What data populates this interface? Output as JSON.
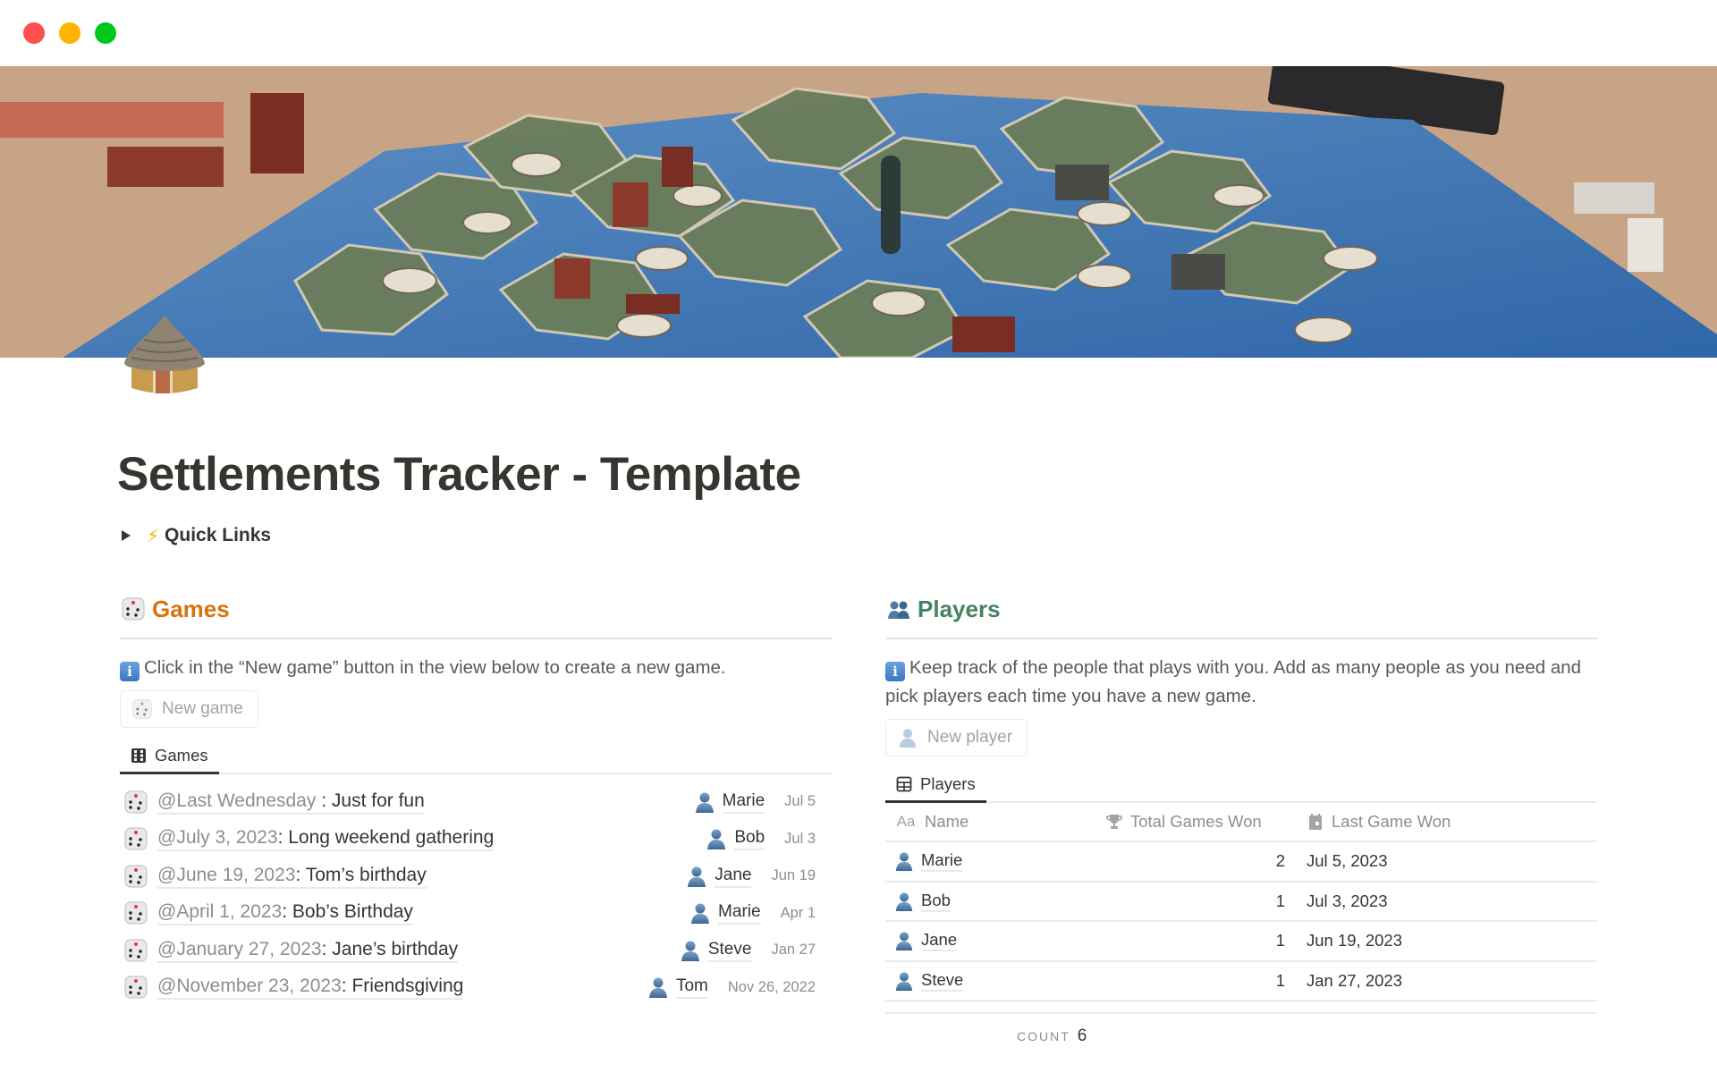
{
  "window": {
    "controls": [
      "close",
      "minimize",
      "zoom"
    ]
  },
  "cover": {
    "description": "Board game (Catan-style hex board) on wooden table",
    "icon": "hut-icon"
  },
  "page": {
    "title": "Settlements Tracker - Template",
    "toggle": {
      "icon": "lightning-icon",
      "label": "Quick Links",
      "expanded": false
    }
  },
  "games": {
    "heading": "Games",
    "heading_icon": "dice-icon",
    "heading_color": "#D9730D",
    "note": "Click in the “New game” button in the view below to create a new game.",
    "new_button": "New game",
    "tab": "Games",
    "rows": [
      {
        "mention": "@Last Wednesday",
        "sep": " : ",
        "title": "Just for fun",
        "winner": "Marie",
        "date": "Jul 5"
      },
      {
        "mention": "@July 3, 2023",
        "sep": ": ",
        "title": "Long weekend gathering",
        "winner": "Bob",
        "date": "Jul 3"
      },
      {
        "mention": "@June 19, 2023",
        "sep": ": ",
        "title": "Tom’s birthday",
        "winner": "Jane",
        "date": "Jun 19"
      },
      {
        "mention": "@April 1, 2023",
        "sep": ": ",
        "title": "Bob’s Birthday",
        "winner": "Marie",
        "date": "Apr 1"
      },
      {
        "mention": "@January 27, 2023",
        "sep": ": ",
        "title": "Jane’s birthday",
        "winner": "Steve",
        "date": "Jan 27"
      },
      {
        "mention": "@November 23, 2023",
        "sep": ": ",
        "title": "Friendsgiving",
        "winner": "Tom",
        "date": "Nov 26, 2022"
      }
    ]
  },
  "players": {
    "heading": "Players",
    "heading_icon": "busts-icon",
    "heading_color": "#448361",
    "note": "Keep track of the people that plays with you. Add as many people as you need and pick players each time you have a new game.",
    "new_button": "New player",
    "tab": "Players",
    "columns": [
      {
        "icon": "Aa",
        "label": "Name"
      },
      {
        "icon": "trophy-icon",
        "label": "Total Games Won"
      },
      {
        "icon": "calendar-icon",
        "label": "Last Game Won"
      }
    ],
    "rows": [
      {
        "name": "Marie",
        "won": "2",
        "last": "Jul 5, 2023"
      },
      {
        "name": "Bob",
        "won": "1",
        "last": "Jul 3, 2023"
      },
      {
        "name": "Jane",
        "won": "1",
        "last": "Jun 19, 2023"
      },
      {
        "name": "Steve",
        "won": "1",
        "last": "Jan 27, 2023"
      }
    ],
    "count_label": "COUNT",
    "count_value": "6"
  }
}
